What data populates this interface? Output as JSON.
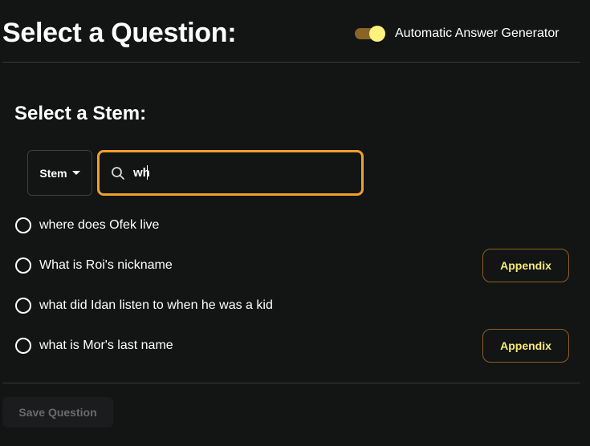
{
  "header": {
    "title": "Select a Question:",
    "toggle": {
      "label": "Automatic Answer Generator",
      "on": true
    }
  },
  "stem_section": {
    "heading": "Select a Stem:",
    "filter_select": {
      "value": "Stem",
      "icon": "chevron-down-icon"
    },
    "search": {
      "value": "wh",
      "icon": "search-icon"
    }
  },
  "questions": [
    {
      "text": "where does Ofek live",
      "appendix": false
    },
    {
      "text": "What is Roi's nickname",
      "appendix": true,
      "appendix_label": "Appendix"
    },
    {
      "text": "what did Idan listen to when he was a kid",
      "appendix": false
    },
    {
      "text": "what is Mor's last name",
      "appendix": true,
      "appendix_label": "Appendix"
    }
  ],
  "footer": {
    "save_label": "Save Question",
    "save_enabled": false
  },
  "colors": {
    "background": "#131414",
    "accent": "#f0a02b",
    "toggle_knob": "#fdf27c",
    "appendix_text": "#f5ec6e"
  }
}
